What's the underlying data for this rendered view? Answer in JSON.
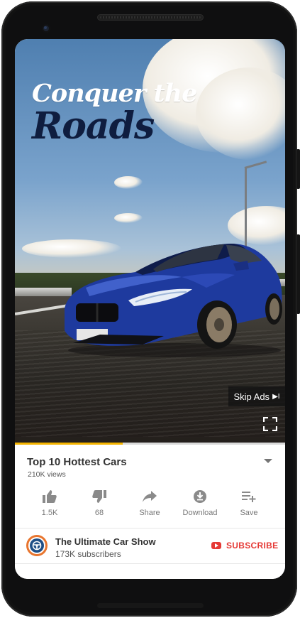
{
  "video": {
    "headline_line1": "Conquer the",
    "headline_line2": "Roads",
    "skip_ads_label": "Skip Ads",
    "skip_icon": "▶I",
    "progress_fraction": 0.4
  },
  "info": {
    "title": "Top 10 Hottest Cars",
    "views": "210K views"
  },
  "actions": [
    {
      "icon": "thumbs-up-icon",
      "label": "1.5K"
    },
    {
      "icon": "thumbs-down-icon",
      "label": "68"
    },
    {
      "icon": "share-icon",
      "label": "Share"
    },
    {
      "icon": "download-icon",
      "label": "Download"
    },
    {
      "icon": "save-playlist-icon",
      "label": "Save"
    }
  ],
  "channel": {
    "name": "The Ultimate Car Show",
    "subscribers": "173K subscribers",
    "subscribe_label": "SUBSCRIBE"
  },
  "colors": {
    "accent_red": "#e53935",
    "progress": "#f4b400",
    "avatar_ring": "#e8752e",
    "car_blue": "#1e3a9e"
  }
}
